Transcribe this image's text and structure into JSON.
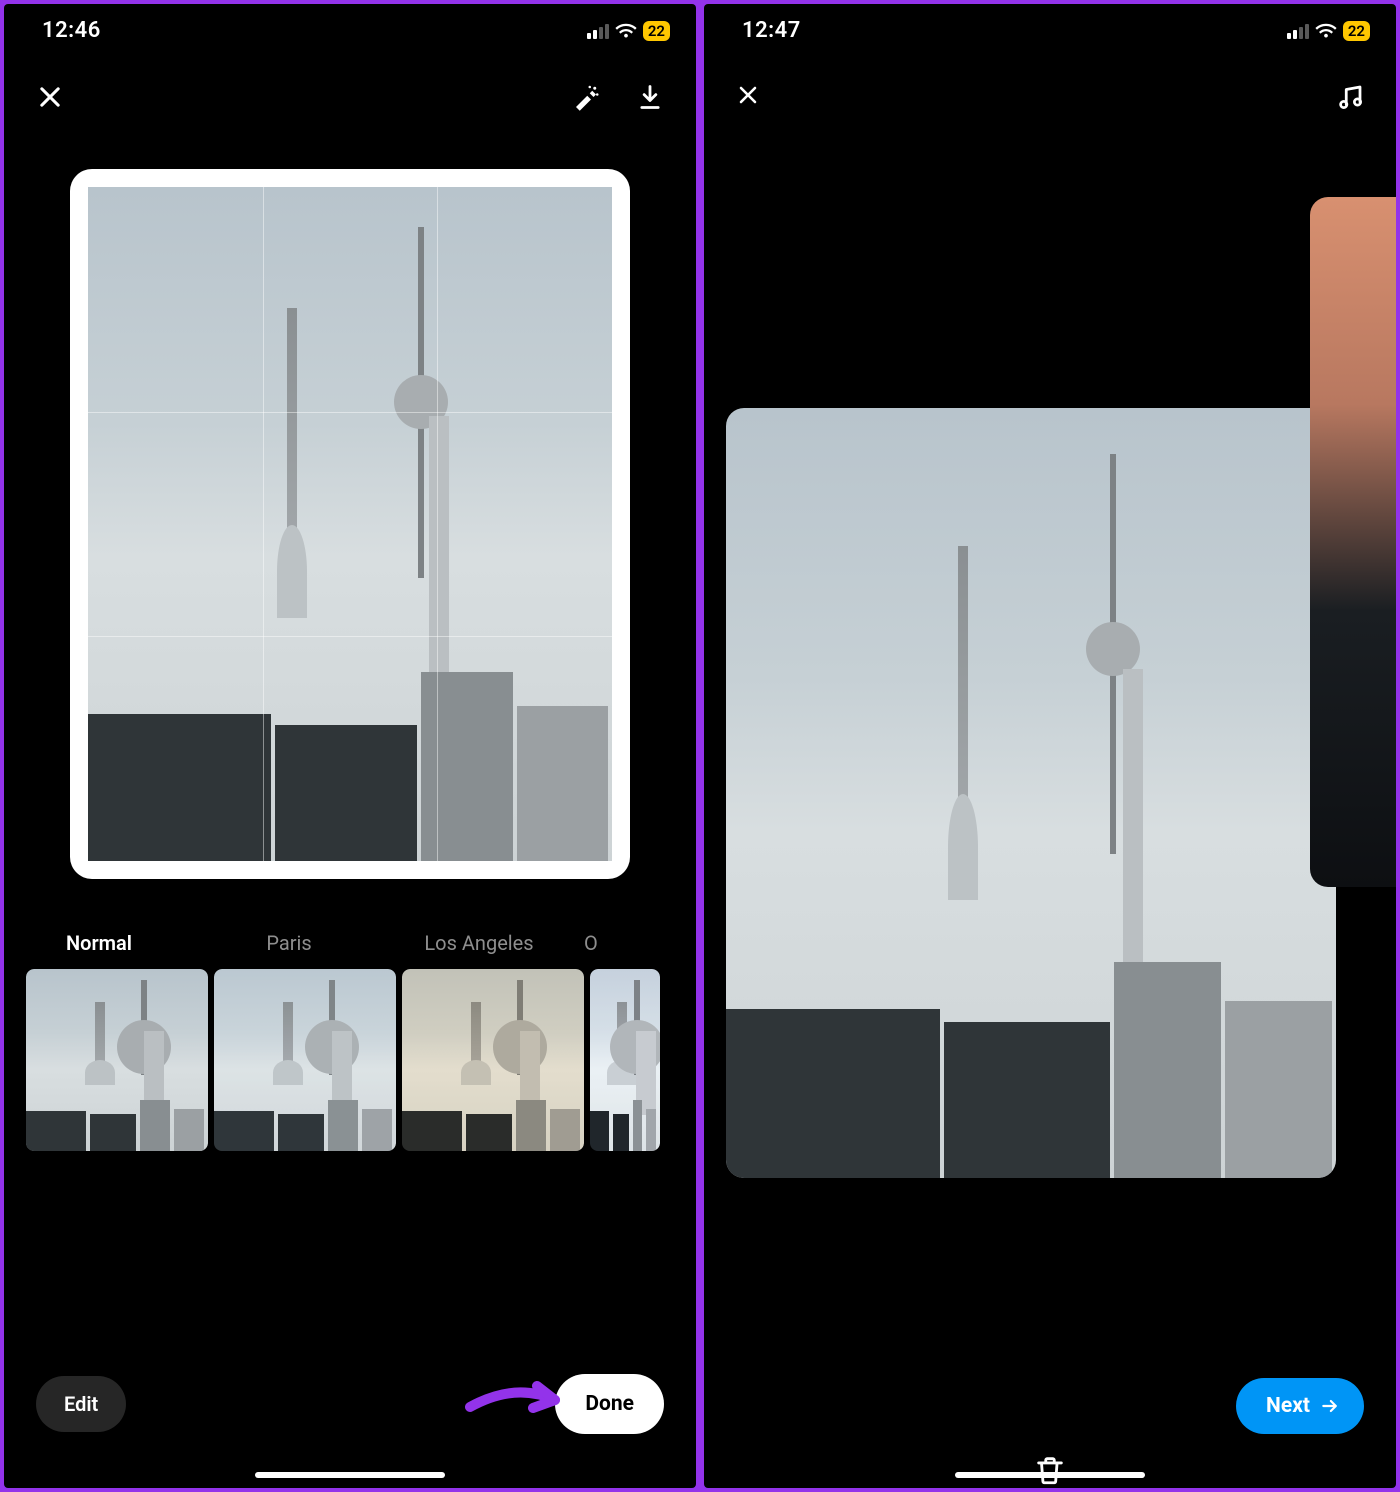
{
  "left": {
    "status": {
      "time": "12:46",
      "battery": "22"
    },
    "filters": [
      {
        "label": "Normal",
        "active": true
      },
      {
        "label": "Paris",
        "active": false
      },
      {
        "label": "Los Angeles",
        "active": false
      },
      {
        "label_partial": "O"
      }
    ],
    "buttons": {
      "edit": "Edit",
      "done": "Done"
    }
  },
  "right": {
    "status": {
      "time": "12:47",
      "battery": "22"
    },
    "buttons": {
      "next": "Next"
    }
  }
}
